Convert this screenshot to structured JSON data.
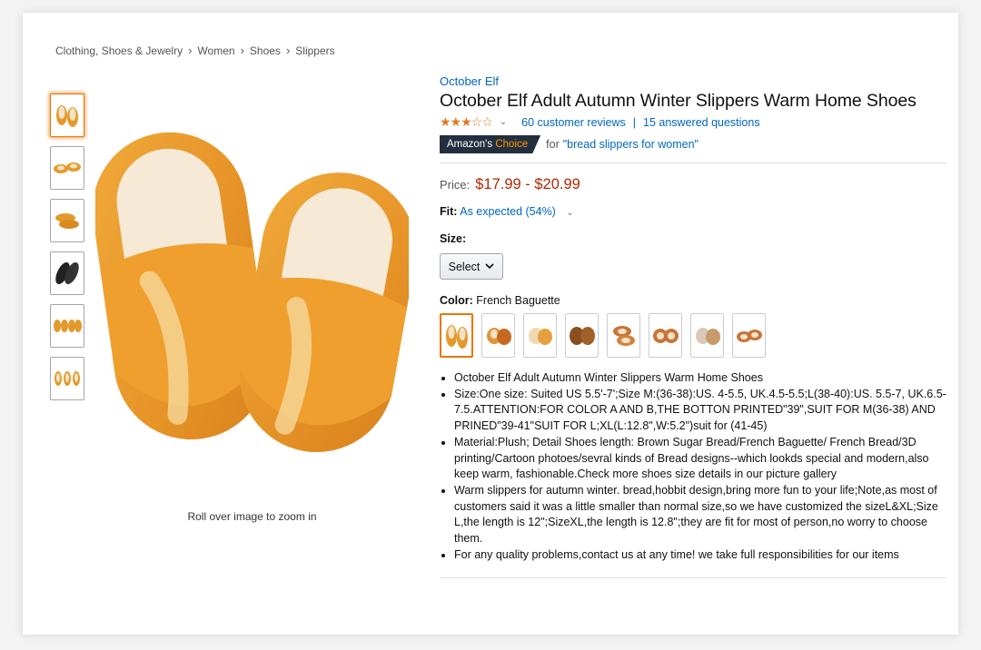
{
  "breadcrumb": [
    "Clothing, Shoes & Jewelry",
    "Women",
    "Shoes",
    "Slippers"
  ],
  "product": {
    "brand": "October Elf",
    "title": "October Elf Adult Autumn Winter Slippers Warm Home Shoes",
    "stars": "★★★☆☆",
    "reviews_link": "60 customer reviews",
    "questions_link": "15 answered questions",
    "badge_prefix": "Amazon's",
    "badge_accent": "Choice",
    "for_text": "for",
    "choice_query": "\"bread slippers for women\"",
    "price_label": "Price:",
    "price": "$17.99 - $20.99",
    "fit_label": "Fit:",
    "fit_value": "As expected (54%)",
    "size_label": "Size:",
    "size_select": "Select",
    "color_label": "Color:",
    "color_value": "French Baguette",
    "zoom_hint": "Roll over image to zoom in",
    "bullets": [
      "October Elf Adult Autumn Winter Slippers Warm Home Shoes",
      "Size:One size: Suited US 5.5'-7';Size M:(36-38):US. 4-5.5, UK.4.5-5.5;L(38-40):US. 5.5-7, UK.6.5-7.5.ATTENTION:FOR COLOR A AND B,THE BOTTON PRINTED\"39\",SUIT FOR M(36-38) AND PRINED\"39-41\"SUIT FOR L;XL(L:12.8\",W:5.2\")suit for (41-45)",
      "Material:Plush; Detail Shoes length: Brown Sugar Bread/French Baguette/ French Bread/3D printing/Cartoon photoes/sevral kinds of Bread designs--which lookds special and modern,also keep warm, fashionable.Check more shoes size details in our picture gallery",
      "Warm slippers for autumn winter. bread,hobbit design,bring more fun to your life;Note,as most of customers said it was a little smaller than normal size,so we have customized the sizeL&XL;Size L,the length is 12\";SizeXL,the length is 12.8\";they are fit for most of person,no worry to choose them.",
      "For any quality problems,contact us at any time! we take full responsibilities for our items"
    ]
  },
  "colors": {
    "link": "#0066c0",
    "price": "#b12704",
    "star": "#de7921",
    "badge_bg": "#232f3e",
    "badge_accent": "#ff9900",
    "selected_border": "#e77600"
  }
}
